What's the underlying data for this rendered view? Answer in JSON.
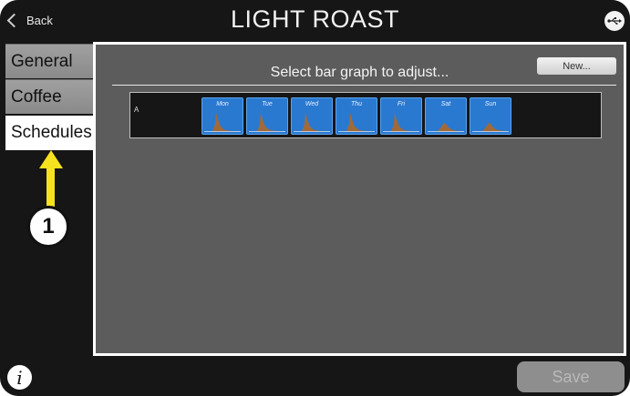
{
  "header": {
    "back_label": "Back",
    "title": "LIGHT ROAST",
    "usb_icon": "usb-icon"
  },
  "tabs": [
    {
      "label": "General",
      "active": false
    },
    {
      "label": "Coffee",
      "active": false
    },
    {
      "label": "Schedules",
      "active": true
    }
  ],
  "main": {
    "instruction": "Select bar graph to adjust...",
    "new_button": "New...",
    "schedules": [
      {
        "label": "A",
        "days": [
          "Mon",
          "Tue",
          "Wed",
          "Thu",
          "Fri",
          "Sat",
          "Sun"
        ]
      }
    ]
  },
  "footer": {
    "info_label": "i",
    "save_label": "Save"
  },
  "annotation": {
    "callout_number": "1",
    "color": "#f6e21f"
  },
  "colors": {
    "background": "#161616",
    "panel": "#5c5c5c",
    "day_tile": "#2a79d0",
    "graph_fill": "#a06a3a"
  }
}
